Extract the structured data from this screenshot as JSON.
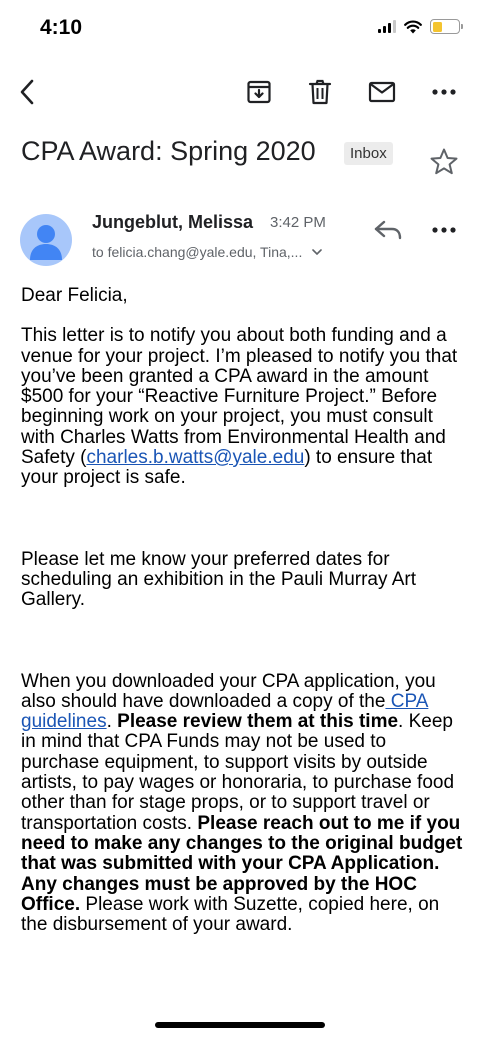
{
  "status_bar": {
    "time": "4:10"
  },
  "toolbar": {
    "back": "back",
    "archive": "archive",
    "delete": "delete",
    "mark_unread": "mark unread",
    "more": "more"
  },
  "email": {
    "subject": "CPA Award:  Spring 2020",
    "label": "Inbox",
    "sender": "Jungeblut, Melissa",
    "time": "3:42 PM",
    "recipients": "to felicia.chang@yale.edu, Tina,...",
    "greeting": "Dear Felicia,",
    "p1_a": "This letter is to notify you about both funding and a venue for your project.  I’m pleased to notify you that you’ve been granted a CPA award in the amount $500 for your “Reactive Furniture Project.”  Before beginning work on your project, you must consult with Charles Watts from Environmental Health and Safety (",
    "p1_link": "charles.b.watts@yale.edu",
    "p1_b": ") to ensure that your project is safe.",
    "p2": "Please let me know your preferred dates for scheduling an exhibition in the Pauli Murray Art Gallery.",
    "p3_a": "When you downloaded your CPA application, you also should have downloaded a copy of the",
    "p3_link": " CPA guidelines",
    "p3_b": ".   ",
    "p3_bold1": "Please review them at this time",
    "p3_c": ". Keep in mind that CPA Funds may not be used to purchase equipment, to support visits by outside artists, to pay wages or honoraria, to purchase food other than for stage props, or to support travel or transportation costs.  ",
    "p3_bold2": "Please reach out to me if you need to make any changes to the original budget that was submitted with your CPA Application.  Any changes must be approved by the HOC Office.",
    "p3_d": "   Please work with Suzette, copied here, on the disbursement of your award."
  },
  "icons": [
    "back-arrow-icon",
    "archive-icon",
    "trash-icon",
    "mail-icon",
    "more-icon",
    "star-icon",
    "reply-icon",
    "chevron-down-icon",
    "avatar-person-icon"
  ],
  "colors": {
    "link": "#1a55b5",
    "avatar_bg": "#a8c7fa",
    "avatar_fg": "#4285f4",
    "battery": "#f4c430"
  }
}
